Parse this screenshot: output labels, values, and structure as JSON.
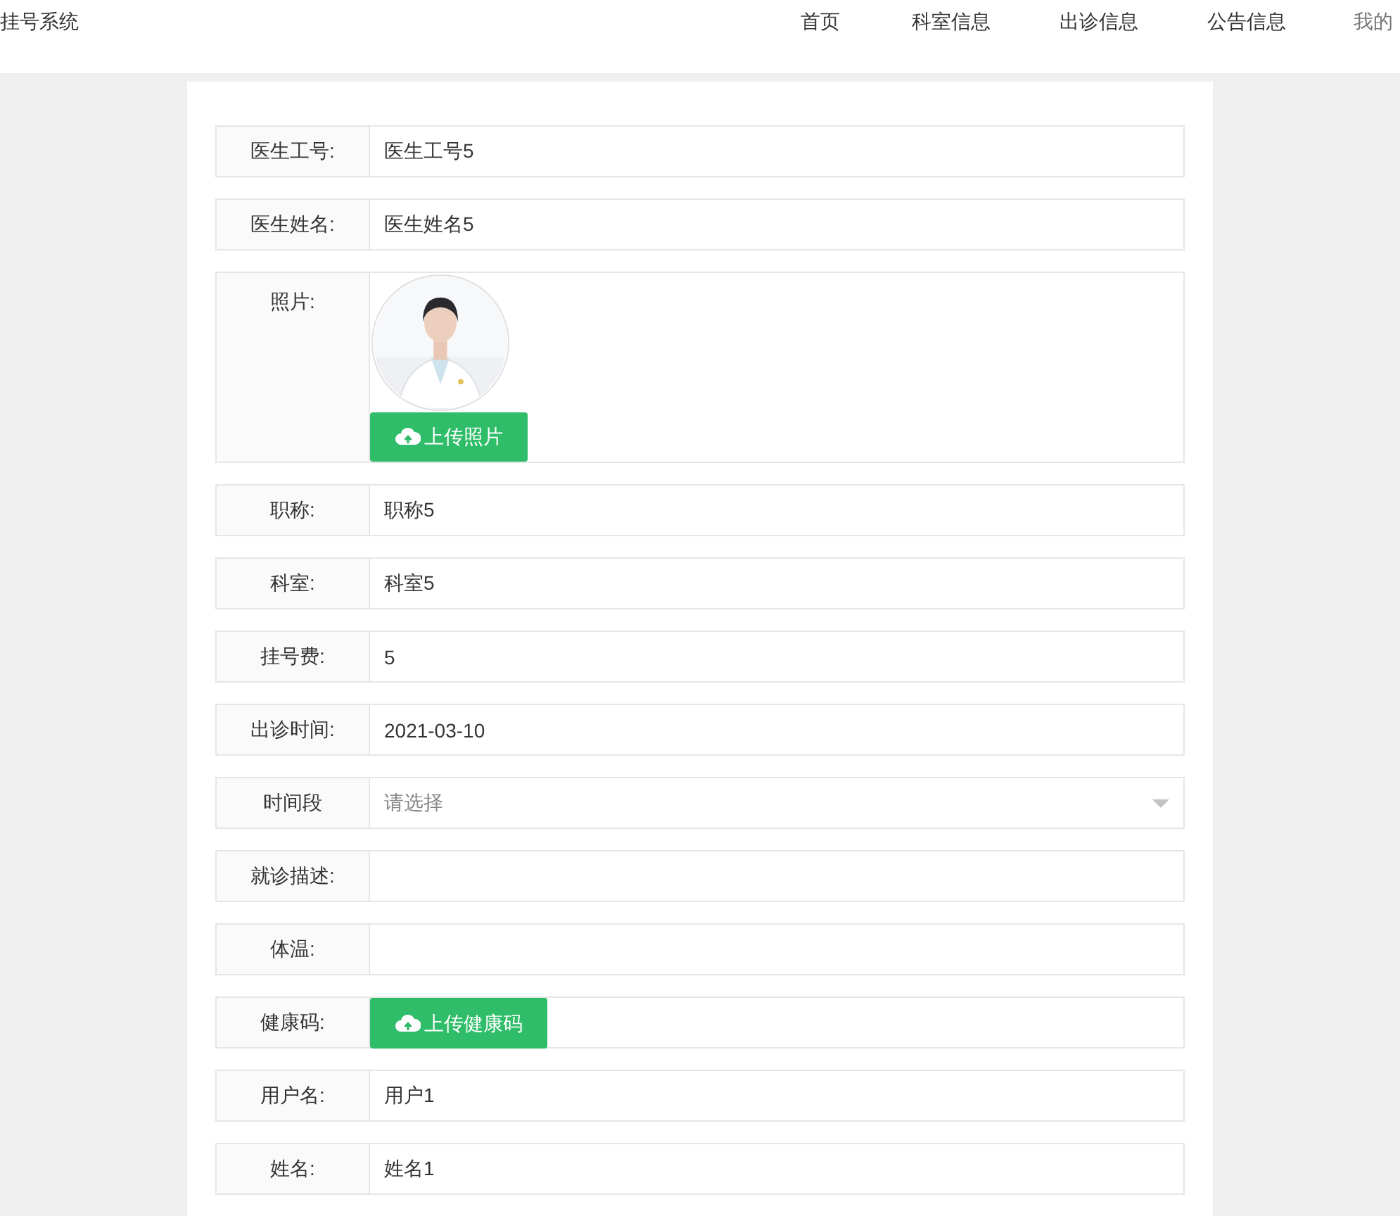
{
  "header": {
    "title": "挂号系统",
    "nav": [
      {
        "label": "首页"
      },
      {
        "label": "科室信息"
      },
      {
        "label": "出诊信息"
      },
      {
        "label": "公告信息"
      },
      {
        "label": "我的"
      }
    ]
  },
  "form": [
    {
      "kind": "text",
      "label": "医生工号:",
      "value": "医生工号5"
    },
    {
      "kind": "text",
      "label": "医生姓名:",
      "value": "医生姓名5"
    },
    {
      "label": "照片:",
      "button": "上传照片"
    },
    {
      "kind": "text",
      "label": "职称:",
      "value": "职称5"
    },
    {
      "kind": "text",
      "label": "科室:",
      "value": "科室5"
    },
    {
      "kind": "text",
      "label": "挂号费:",
      "value": "5"
    },
    {
      "kind": "text",
      "label": "出诊时间:",
      "value": "2021-03-10"
    },
    {
      "kind": "select",
      "label": "时间段",
      "placeholder": "请选择"
    },
    {
      "kind": "text",
      "label": "就诊描述:"
    },
    {
      "kind": "text",
      "label": "体温:"
    },
    {
      "kind": "upload",
      "label": "健康码:",
      "button": "上传健康码"
    },
    {
      "kind": "text",
      "label": "用户名:",
      "value": "用户1"
    },
    {
      "kind": "text",
      "label": "姓名:",
      "value": "姓名1"
    }
  ]
}
